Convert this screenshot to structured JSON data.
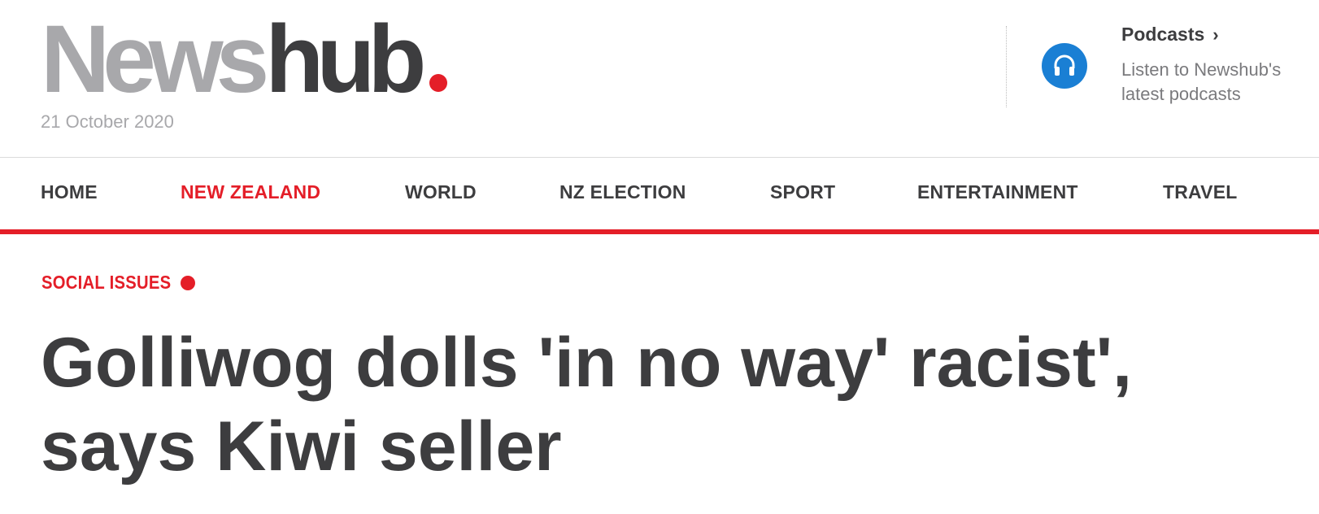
{
  "brand": {
    "logo_part1": "News",
    "logo_part2": "hub",
    "logo_grey": "#a8a8ab",
    "logo_dark": "#3d3d3f",
    "accent": "#e41e28",
    "date": "21 October 2020"
  },
  "podcasts": {
    "icon": "headphones-icon",
    "icon_bg": "#1a7fd4",
    "title": "Podcasts",
    "chevron": "›",
    "description": "Listen to Newshub's latest podcasts"
  },
  "nav": {
    "items": [
      {
        "label": "HOME",
        "active": false
      },
      {
        "label": "NEW ZEALAND",
        "active": true
      },
      {
        "label": "WORLD",
        "active": false
      },
      {
        "label": "NZ ELECTION",
        "active": false
      },
      {
        "label": "SPORT",
        "active": false
      },
      {
        "label": "ENTERTAINMENT",
        "active": false
      },
      {
        "label": "TRAVEL",
        "active": false
      }
    ],
    "rule_color": "#e41e28"
  },
  "article": {
    "category": "SOCIAL ISSUES",
    "category_color": "#e41e28",
    "headline": "Golliwog dolls 'in no way' racist', says Kiwi seller"
  }
}
